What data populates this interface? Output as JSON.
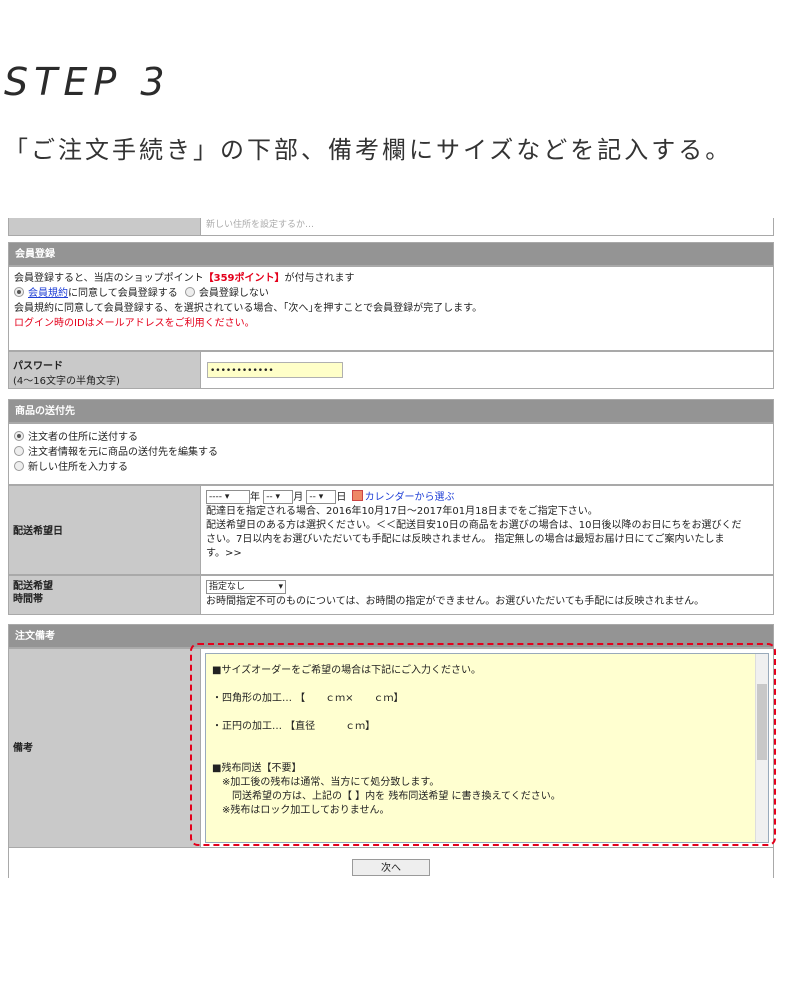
{
  "heading": {
    "step": "STEP 3",
    "description": "「ご注文手続き」の下部、備考欄にサイズなどを記入する。"
  },
  "top_partial": {
    "text": "新しい住所を設定するか…"
  },
  "member": {
    "header": "会員登録",
    "line1_pre": "会員登録すると、当店のショップポイント",
    "line1_points": "【359ポイント】",
    "line1_post": "が付与されます",
    "option_agree_link": "会員規約",
    "option_agree_rest": "に同意して会員登録する",
    "option_no": "会員登録しない",
    "note": "会員規約に同意して会員登録する、を選択されている場合、｢次へ｣を押すことで会員登録が完了します。",
    "login_note": "ログイン時のIDはメールアドレスをご利用ください。",
    "password_label": "パスワード",
    "password_hint": "(4〜16文字の半角文字)",
    "password_value": "••••••••••••"
  },
  "shipping": {
    "header": "商品の送付先",
    "options": [
      "注文者の住所に送付する",
      "注文者情報を元に商品の送付先を編集する",
      "新しい住所を入力する"
    ]
  },
  "delivery_date": {
    "label": "配送希望日",
    "year_select": "----",
    "year_unit": "年",
    "month_select": "--",
    "month_unit": "月",
    "day_select": "--",
    "day_unit": "日",
    "calendar_link": "カレンダーから選ぶ",
    "line1": "配達日を指定される場合、2016年10月17日〜2017年01月18日までをご指定下さい。",
    "line2": "配送希望日のある方は選択ください。＜＜配送目安10日の商品をお選びの場合は、10日後以降のお日にちをお選びくだ",
    "line3": "さい。7日以内をお選びいただいても手配には反映されません。 指定無しの場合は最短お届け日にてご案内いたしま",
    "line4": "す。>>"
  },
  "delivery_time": {
    "label_line1": "配送希望",
    "label_line2": "時間帯",
    "select": "指定なし",
    "note": "お時間指定不可のものについては、お時間の指定ができません。お選びいただいても手配には反映されません。"
  },
  "remarks": {
    "header": "注文備考",
    "label": "備考",
    "text": "■サイズオーダーをご希望の場合は下記にご入力ください。\n\n・四角形の加工… 【　　ｃｍ×　　ｃｍ】\n\n・正円の加工… 【直径　　　ｃｍ】\n\n\n■残布同送【不要】\n　※加工後の残布は通常、当方にて処分致します。\n　　同送希望の方は、上記の【 】内を 残布同送希望 に書き換えてください。\n　※残布はロック加工しておりません。"
  },
  "buttons": {
    "next": "次へ"
  },
  "colors": {
    "header_bg": "#949494",
    "label_bg": "#c9c9c9",
    "accent_red": "#e4001b",
    "field_bg": "#ffffd0"
  }
}
